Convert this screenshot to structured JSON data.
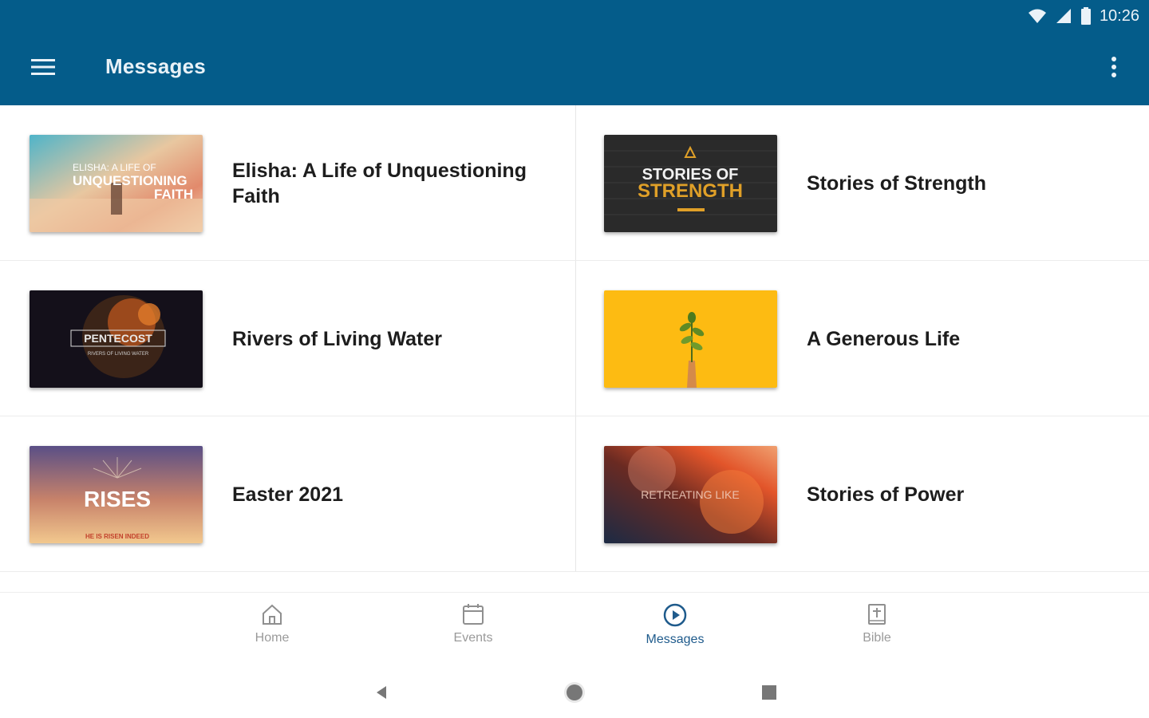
{
  "status_bar": {
    "time": "10:26"
  },
  "app_bar": {
    "title": "Messages"
  },
  "series": [
    {
      "title": "Elisha: A Life of Unquestioning Faith",
      "thumbnail_text": [
        "ELISHA: A LIFE OF",
        "UNQUESTIONING",
        "FAITH"
      ]
    },
    {
      "title": "Stories of Strength",
      "thumbnail_text": [
        "STORIES OF",
        "STRENGTH"
      ]
    },
    {
      "title": "Rivers of Living Water",
      "thumbnail_text": [
        "PENTECOST",
        "RIVERS OF LIVING WATER"
      ]
    },
    {
      "title": "A Generous Life",
      "thumbnail_text": []
    },
    {
      "title": "Easter 2021",
      "thumbnail_text": [
        "RISES",
        "HE IS RISEN INDEED"
      ]
    },
    {
      "title": "Stories of Power",
      "thumbnail_text": [
        "RETREATING LIKE"
      ]
    }
  ],
  "bottom_nav": {
    "items": [
      {
        "label": "Home",
        "icon": "home-icon"
      },
      {
        "label": "Events",
        "icon": "calendar-icon"
      },
      {
        "label": "Messages",
        "icon": "play-circle-icon",
        "active": true
      },
      {
        "label": "Bible",
        "icon": "bible-icon"
      }
    ]
  },
  "colors": {
    "app_bar": "#045c8a",
    "active_nav": "#1f5b8c",
    "inactive_nav": "#9a9a9a"
  }
}
